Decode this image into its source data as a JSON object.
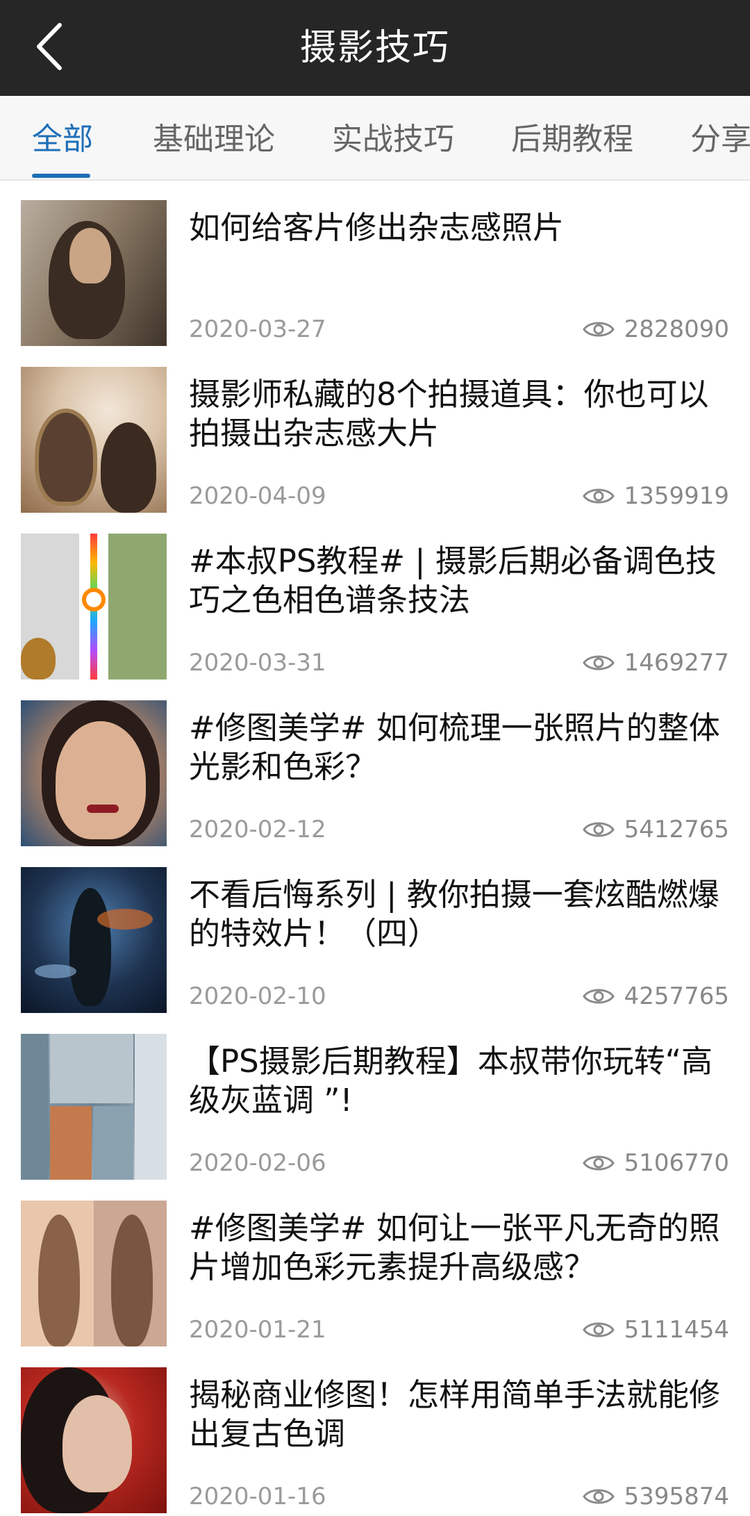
{
  "header": {
    "title": "摄影技巧"
  },
  "tabs": [
    {
      "label": "全部",
      "active": true
    },
    {
      "label": "基础理论",
      "active": false
    },
    {
      "label": "实战技巧",
      "active": false
    },
    {
      "label": "后期教程",
      "active": false
    },
    {
      "label": "分享",
      "active": false
    }
  ],
  "articles": [
    {
      "title": "如何给客片修出杂志感照片",
      "date": "2020-03-27",
      "views": "2828090",
      "thumb_icon": "portrait-thumbnail"
    },
    {
      "title": "摄影师私藏的8个拍摄道具：你也可以拍摄出杂志感大片",
      "date": "2020-04-09",
      "views": "1359919",
      "thumb_icon": "mirror-portrait-thumbnail"
    },
    {
      "title": "#本叔PS教程# | 摄影后期必备调色技巧之色相色谱条技法",
      "date": "2020-03-31",
      "views": "1469277",
      "thumb_icon": "color-spectrum-thumbnail"
    },
    {
      "title": "#修图美学# 如何梳理一张照片的整体光影和色彩？",
      "date": "2020-02-12",
      "views": "5412765",
      "thumb_icon": "face-portrait-thumbnail"
    },
    {
      "title": "不看后悔系列 | 教你拍摄一套炫酷燃爆的特效片！（四）",
      "date": "2020-02-10",
      "views": "4257765",
      "thumb_icon": "effects-thumbnail"
    },
    {
      "title": "【PS摄影后期教程】本叔带你玩转“高级灰蓝调 ”!",
      "date": "2020-02-06",
      "views": "5106770",
      "thumb_icon": "city-collage-thumbnail"
    },
    {
      "title": "#修图美学# 如何让一张平凡无奇的照片增加色彩元素提升高级感？",
      "date": "2020-01-21",
      "views": "5111454",
      "thumb_icon": "fashion-comparison-thumbnail"
    },
    {
      "title": "揭秘商业修图！怎样用简单手法就能修出复古色调",
      "date": "2020-01-16",
      "views": "5395874",
      "thumb_icon": "red-portrait-thumbnail"
    }
  ],
  "colors": {
    "header_bg": "#262626",
    "accent": "#1e6fb8",
    "tab_bg": "#f7f7f7"
  }
}
